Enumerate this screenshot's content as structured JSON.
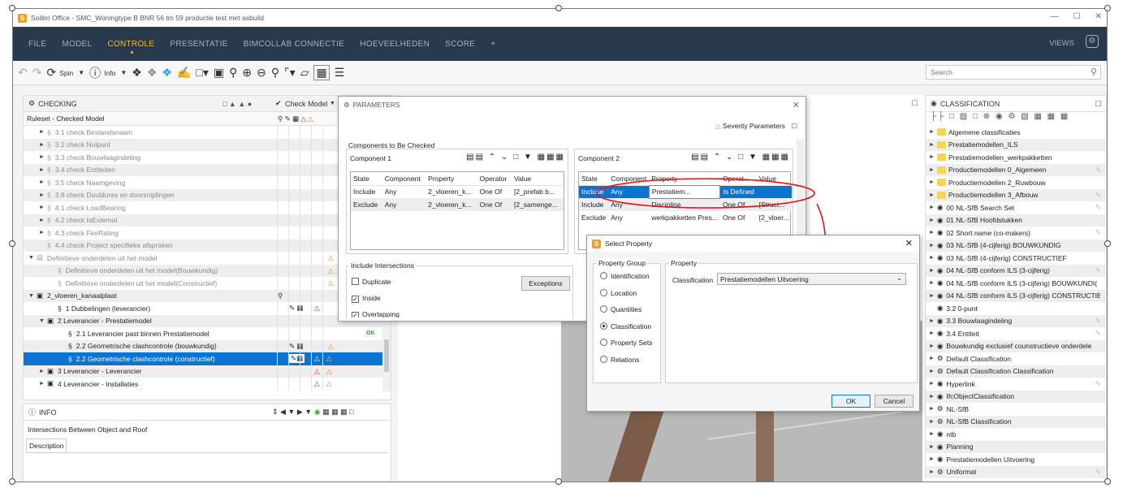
{
  "window": {
    "title": "Solibri Office - SMC_Woningtype B BNR 56 tm 59 productie test met asbuild"
  },
  "menu": {
    "items": [
      "FILE",
      "MODEL",
      "CONTROLE",
      "PRESENTATIE",
      "BIMCOLLAB CONNECTIE",
      "HOEVEELHEDEN",
      "SCORE",
      "+"
    ],
    "active": "CONTROLE",
    "views_label": "VIEWS"
  },
  "toolbar": {
    "spin_label": "Spin",
    "info_label": "Info",
    "search_placeholder": "Search"
  },
  "checking": {
    "title": "CHECKING",
    "check_model_label": "Check Model",
    "ruleset_label": "Ruleset - Checked Model",
    "rows": [
      {
        "indent": 1,
        "tri": "►",
        "ico": "§",
        "text": "3.1 check Bestandsnaam",
        "grey": true,
        "alt": false,
        "flags": ""
      },
      {
        "indent": 1,
        "tri": "►",
        "ico": "§",
        "text": "3.2 check Nulpunt",
        "grey": true,
        "alt": true,
        "flags": ""
      },
      {
        "indent": 1,
        "tri": "►",
        "ico": "§",
        "text": "3.3 check Bouwlaagindeling",
        "grey": true,
        "alt": false,
        "flags": ""
      },
      {
        "indent": 1,
        "tri": "►",
        "ico": "§",
        "text": "3.4 check Entiteiten",
        "grey": true,
        "alt": true,
        "flags": ""
      },
      {
        "indent": 1,
        "tri": "►",
        "ico": "§",
        "text": "3.5 check Naamgeving",
        "grey": true,
        "alt": false,
        "flags": ""
      },
      {
        "indent": 1,
        "tri": "►",
        "ico": "§",
        "text": "3.8 check Doublures en doorsnijdingen",
        "grey": true,
        "alt": true,
        "flags": ""
      },
      {
        "indent": 1,
        "tri": "►",
        "ico": "§",
        "text": "4.1 check LoadBearing",
        "grey": true,
        "alt": false,
        "flags": ""
      },
      {
        "indent": 1,
        "tri": "►",
        "ico": "§",
        "text": "4.2 check IsExternal",
        "grey": true,
        "alt": true,
        "flags": ""
      },
      {
        "indent": 1,
        "tri": "►",
        "ico": "§",
        "text": "4.3 check FireRating",
        "grey": true,
        "alt": false,
        "flags": ""
      },
      {
        "indent": 1,
        "tri": "",
        "ico": "§",
        "text": "4.4 check Project specifieke afspraken",
        "grey": true,
        "alt": true,
        "flags": ""
      },
      {
        "indent": 0,
        "tri": "▼",
        "ico": "▤",
        "text": "Definitieve onderdelen uit het model",
        "grey": true,
        "alt": false,
        "flags": "ws"
      },
      {
        "indent": 2,
        "tri": "",
        "ico": "§",
        "text": "Definitieve onderdelen uit het model(Bouwkundig)",
        "grey": true,
        "alt": true,
        "flags": "ws"
      },
      {
        "indent": 2,
        "tri": "",
        "ico": "§",
        "text": "Definitieve onderdelen uit het model(Constructief)",
        "grey": true,
        "alt": false,
        "flags": "ws"
      },
      {
        "indent": 0,
        "tri": "▼",
        "ico": "▣",
        "text": "2_vloeren_kanaalplaat",
        "grey": false,
        "alt": true,
        "flags": ""
      },
      {
        "indent": 2,
        "tri": "",
        "ico": "§",
        "text": "1 Dubbelingen (leverancier)",
        "grey": false,
        "alt": false,
        "flags": "r"
      },
      {
        "indent": 1,
        "tri": "▼",
        "ico": "▣",
        "text": "2 Leverancier - Prestatiemodel",
        "grey": false,
        "alt": true,
        "flags": ""
      },
      {
        "indent": 3,
        "tri": "",
        "ico": "§",
        "text": "2.1 Leverancier past binnen Prestatiemodel",
        "grey": false,
        "alt": false,
        "flags": "ok"
      },
      {
        "indent": 3,
        "tri": "",
        "ico": "§",
        "text": "2.2 Geometrische clashcontrole (bouwkundig)",
        "grey": false,
        "alt": true,
        "flags": "ws"
      },
      {
        "indent": 3,
        "tri": "",
        "ico": "§",
        "text": "2.2 Geometrische clashcontrole (constructief)",
        "grey": false,
        "alt": false,
        "sel": true,
        "flags": "rw"
      },
      {
        "indent": 1,
        "tri": "►",
        "ico": "▣",
        "text": "3 Leverancier - Leverancier",
        "grey": false,
        "alt": true,
        "flags": "rw"
      },
      {
        "indent": 1,
        "tri": "►",
        "ico": "▣",
        "text": "4 Leverancier - Installaties",
        "grey": false,
        "alt": false,
        "flags": "rw"
      }
    ]
  },
  "info": {
    "title": "INFO",
    "text": "Intersections Between Object and Roof",
    "tab": "Description"
  },
  "parameters": {
    "title": "PARAMETERS",
    "severity_label": "Severity Parameters",
    "components_label": "Components to Be Checked",
    "component1": {
      "title": "Component 1",
      "headers": [
        "State",
        "Component",
        "Property",
        "Operator",
        "Value"
      ],
      "rows": [
        [
          "Include",
          "Any",
          "2_vloeren_k...",
          "One Of",
          "[2_prefab b..."
        ],
        [
          "Exclude",
          "Any",
          "2_vloeren_k...",
          "One Of",
          "[2_samenge..."
        ]
      ]
    },
    "component2": {
      "title": "Component 2",
      "headers": [
        "State",
        "Component",
        "Property",
        "Operat...",
        "Value"
      ],
      "rows": [
        [
          "Include",
          "Any",
          "Prestatiem...",
          "Is Defined",
          ""
        ],
        [
          "Include",
          "Any",
          "Discipline",
          "One Of",
          "[Struct..."
        ],
        [
          "Exclude",
          "Any",
          "werkpakketten Pres...",
          "One Of",
          "[2_vloer..."
        ]
      ]
    },
    "intersections": {
      "title": "Include Intersections",
      "duplicate": "Duplicate",
      "inside": "Inside",
      "overlapping": "Overlapping",
      "exceptions": "Exceptions"
    }
  },
  "select_property": {
    "title": "Select Property",
    "group_title": "Property Group",
    "groups": [
      "Identification",
      "Location",
      "Quantities",
      "Classification",
      "Property Sets",
      "Relations"
    ],
    "selected_group": "Classification",
    "property_title": "Property",
    "classification_label": "Classification",
    "classification_value": "Prestatiemodellen Uitvoering",
    "ok": "OK",
    "cancel": "Cancel"
  },
  "classification": {
    "title": "CLASSIFICATION",
    "items": [
      {
        "ico": "folder",
        "text": "Algemene classificaties",
        "link": false
      },
      {
        "ico": "folder",
        "text": "Prestatiemodellen_ILS",
        "link": false
      },
      {
        "ico": "folder",
        "text": "Prestatiemodellen_werkpakketten",
        "link": false
      },
      {
        "ico": "folder",
        "text": "Productiemodellen 0_Algemeen",
        "link": true
      },
      {
        "ico": "folder",
        "text": "Productiemodellen 2_Ruwbouw",
        "link": false
      },
      {
        "ico": "folder",
        "text": "Productiemodellen 3_Afbouw",
        "link": true
      },
      {
        "ico": "eye",
        "text": "00 NL-SfB Search Set",
        "link": true
      },
      {
        "ico": "eye",
        "text": "01 NL-SfB Hoofdstukken",
        "link": false
      },
      {
        "ico": "eye",
        "text": "02 Short name (co-makers)",
        "link": true
      },
      {
        "ico": "eye",
        "text": "03 NL-SfB (4-cijferig) BOUWKUNDIG",
        "link": false
      },
      {
        "ico": "eye",
        "text": "03 NL-SfB (4-cijferig) CONSTRUCTIEF",
        "link": false
      },
      {
        "ico": "eye",
        "text": "04 NL-SfB conform ILS (3-cijferig)",
        "link": true
      },
      {
        "ico": "eye",
        "text": "04 NL-SfB conform ILS (3-cijferig) BOUWKUNDI(",
        "link": false
      },
      {
        "ico": "eye",
        "text": "04 NL-SfB conform ILS (3-cijferig) CONSTRUCTIE",
        "link": false
      },
      {
        "ico": "eye",
        "text": "3.2 0-punt",
        "link": false,
        "noarrow": true
      },
      {
        "ico": "eye",
        "text": "3.3 Bouwlaagindeling",
        "link": true
      },
      {
        "ico": "eye",
        "text": "3.4 Entiteit",
        "link": true
      },
      {
        "ico": "eye",
        "text": "Bouwkundig exclusief counstructieve onderdele",
        "link": false
      },
      {
        "ico": "gear",
        "text": "Default Classification",
        "link": false
      },
      {
        "ico": "gear",
        "text": "Default Classification Classification",
        "link": false
      },
      {
        "ico": "eye",
        "text": "Hyperlink",
        "link": true
      },
      {
        "ico": "eye",
        "text": "IfcObjectClassification",
        "link": false
      },
      {
        "ico": "gear",
        "text": "NL-SfB",
        "link": false
      },
      {
        "ico": "gear",
        "text": "NL-SfB Classification",
        "link": false
      },
      {
        "ico": "eye",
        "text": "ntb",
        "link": false
      },
      {
        "ico": "eye",
        "text": "Planning",
        "link": false
      },
      {
        "ico": "eye",
        "text": "Prestatiemodellen Uitvoering",
        "link": false
      },
      {
        "ico": "gear",
        "text": "Uniformat",
        "link": true
      }
    ]
  }
}
